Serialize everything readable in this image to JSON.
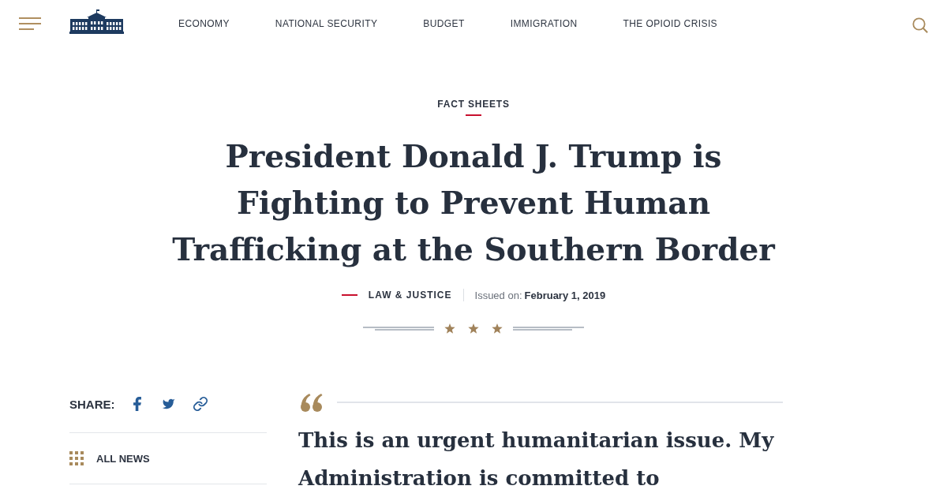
{
  "header": {
    "nav": [
      "ECONOMY",
      "NATIONAL SECURITY",
      "BUDGET",
      "IMMIGRATION",
      "THE OPIOID CRISIS"
    ]
  },
  "article": {
    "category": "FACT SHEETS",
    "title": "President Donald J. Trump is Fighting to Prevent Human Trafficking at the Southern Border",
    "topic": "LAW & JUSTICE",
    "issued_label": "Issued on:",
    "issued_date": "February 1, 2019"
  },
  "sidebar": {
    "share_label": "SHARE:",
    "links": [
      "ALL NEWS"
    ]
  },
  "quote": {
    "text": "This is an urgent humanitarian issue. My Administration is committed to"
  }
}
